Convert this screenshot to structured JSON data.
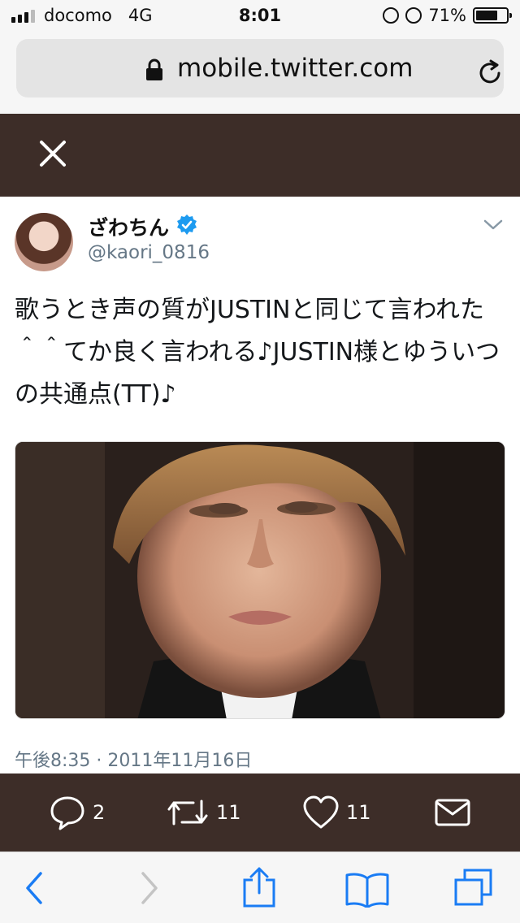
{
  "status_bar": {
    "carrier": "docomo",
    "network": "4G",
    "time": "8:01",
    "battery": "71%",
    "battery_level": 0.71
  },
  "address_bar": {
    "url": "mobile.twitter.com",
    "lock_icon": "lock-icon",
    "reload_icon": "reload-icon"
  },
  "header": {
    "close_icon": "close-icon"
  },
  "tweet": {
    "display_name": "ざわちん",
    "handle": "@kaori_0816",
    "verified": true,
    "text": "歌うとき声の質がJUSTINと同じて言われた＾＾てか良く言われる♪JUSTIN様とゆういつの共通点(TT)♪",
    "timestamp": "午後8:35 · 2011年11月16日"
  },
  "actions": {
    "reply_count": "2",
    "retweet_count": "11",
    "like_count": "11"
  },
  "toolbar": {
    "icons": [
      "back-icon",
      "forward-icon",
      "share-icon",
      "bookmarks-icon",
      "tabs-icon"
    ]
  },
  "colors": {
    "header_bg": "#3d2d28",
    "link_blue": "#1d9bf0",
    "ios_blue": "#1a7cf4",
    "meta_gray": "#657786"
  }
}
